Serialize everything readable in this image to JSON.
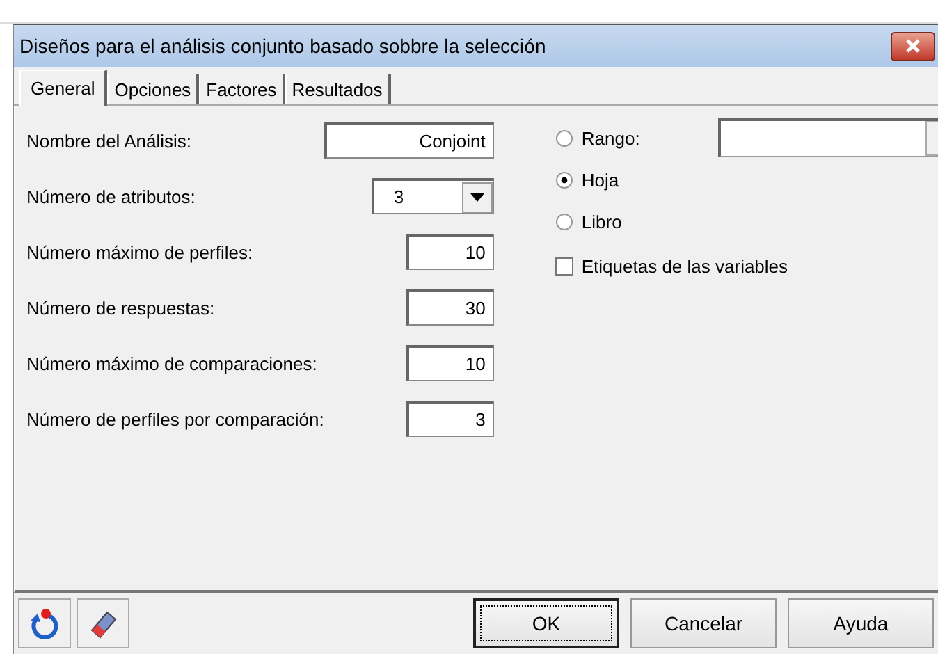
{
  "window": {
    "title": "Diseños para el análisis conjunto basado sobbre la selección"
  },
  "tabs": [
    {
      "label": "General",
      "selected": true
    },
    {
      "label": "Opciones",
      "selected": false
    },
    {
      "label": "Factores",
      "selected": false
    },
    {
      "label": "Resultados",
      "selected": false
    }
  ],
  "fields": [
    {
      "label": "Nombre del Análisis:",
      "kind": "wide",
      "value": "Conjoint"
    },
    {
      "label": "Número de atributos:",
      "kind": "combo",
      "value": "3"
    },
    {
      "label": "Número máximo de perfiles:",
      "kind": "number",
      "value": "10"
    },
    {
      "label": "Número de respuestas:",
      "kind": "number",
      "value": "30"
    },
    {
      "label": "Número máximo de comparaciones:",
      "kind": "number",
      "value": "10"
    },
    {
      "label": "Número de perfiles por comparación:",
      "kind": "number",
      "value": "3"
    }
  ],
  "output": [
    {
      "label": "Rango:",
      "selected": false
    },
    {
      "label": "Hoja",
      "selected": true
    },
    {
      "label": "Libro",
      "selected": false
    }
  ],
  "variable_labels": {
    "label": "Etiquetas de las variables",
    "checked": false
  },
  "buttons": [
    {
      "label": "OK",
      "default": true
    },
    {
      "label": "Cancelar",
      "default": false
    },
    {
      "label": "Ayuda",
      "default": false
    }
  ]
}
